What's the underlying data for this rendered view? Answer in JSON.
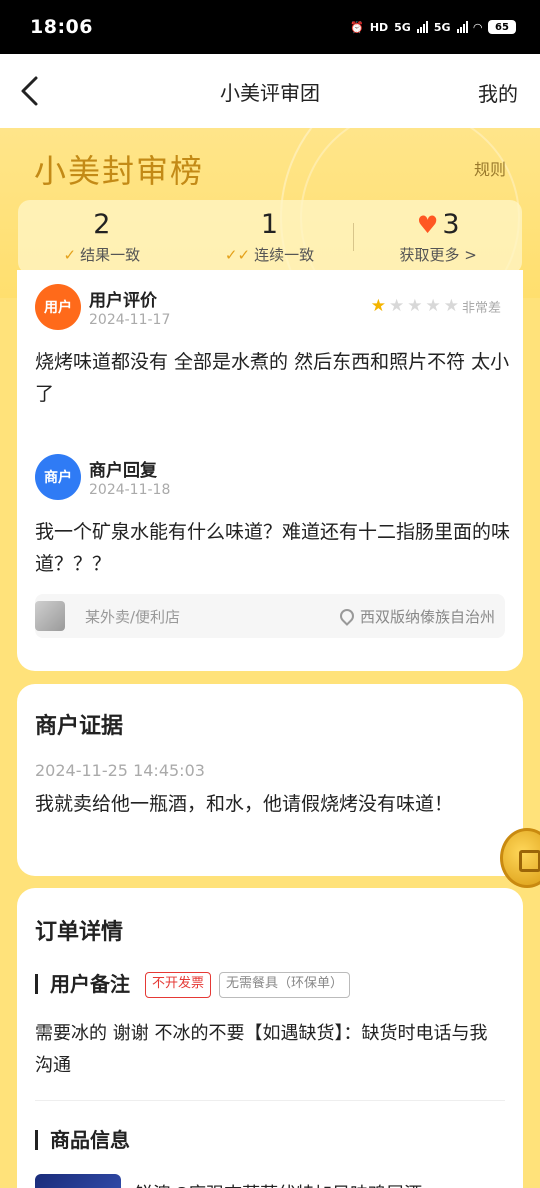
{
  "status_bar": {
    "time": "18:06",
    "icons": [
      "alarm-icon",
      "hd-icon",
      "signal-5g-icon",
      "signal-5g-icon",
      "wifi-icon",
      "battery-icon"
    ],
    "hd_label": "HD",
    "net1": "5G",
    "net2": "5G",
    "battery": "65"
  },
  "nav": {
    "back_icon": "chevron-left-icon",
    "title": "小美评审团",
    "right_label": "我的"
  },
  "banner": {
    "title": "小美封审榜",
    "rules_label": "规则",
    "stats": [
      {
        "value": "2",
        "label": "结果一致"
      },
      {
        "value": "1",
        "label": "连续一致"
      },
      {
        "value": "3",
        "label": "获取更多 >"
      }
    ]
  },
  "review": {
    "user": {
      "avatar_label": "用户",
      "name": "用户评价",
      "date": "2024-11-17",
      "rating": 1,
      "rating_max": 5,
      "rating_label": "非常差",
      "text": "烧烤味道都没有 全部是水煮的 然后东西和照片不符 太小了"
    },
    "merchant": {
      "avatar_label": "商户",
      "name": "商户回复",
      "date": "2024-11-18",
      "text": "我一个矿泉水能有什么味道？难道还有十二指肠里面的味道？？？"
    },
    "shop": {
      "name": "某外卖/便利店",
      "location": "西双版纳傣族自治州"
    }
  },
  "evidence": {
    "title": "商户证据",
    "date": "2024-11-25 14:45:03",
    "text": "我就卖给他一瓶酒，和水，他请假烧烤没有味道！"
  },
  "order": {
    "title": "订单详情",
    "remark_title": "用户备注",
    "tags": [
      "不开发票",
      "无需餐具（环保单）"
    ],
    "remark_text": "需要冰的 谢谢 不冰的不要【如遇缺货】：缺货时电话与我沟通",
    "product_title": "商品信息",
    "product_name": "锐澳 3度强爽蓝莓伏特加风味鸡尾酒"
  },
  "colors": {
    "accent": "#ffe27a",
    "banner_title": "#c38a16",
    "user_avatar": "#ff6a1a",
    "merchant_avatar": "#2f7bf5",
    "heart": "#ff5722",
    "tag_red": "#e53935"
  }
}
